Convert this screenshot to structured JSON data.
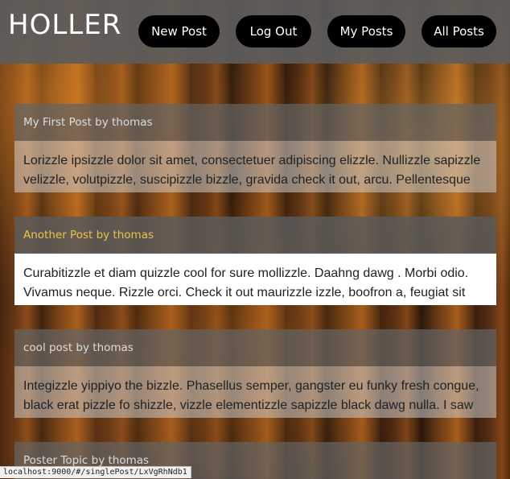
{
  "app": {
    "title": "HOLLER"
  },
  "nav": {
    "new_post": "New Post",
    "log_out": "Log Out",
    "my_posts": "My Posts",
    "all_posts": "All Posts"
  },
  "posts": [
    {
      "header": "My First Post by thomas",
      "body": "Lorizzle ipsizzle dolor sit amet, consectetuer adipiscing elizzle. Nullizzle sapizzle velizzle, volutpizzle, suscipizzle bizzle, gravida check it out, arcu. Pellentesque"
    },
    {
      "header": "Another Post by thomas",
      "body": "Curabitizzle et diam quizzle cool for sure mollizzle. Daahng dawg . Morbi odio. Vivamus neque. Rizzle orci. Check it out maurizzle izzle, boofron a, feugiat sit"
    },
    {
      "header": "cool post by thomas",
      "body": "Integizzle yippiyo the bizzle. Phasellus semper, gangster eu funky fresh congue, black erat pizzle fo shizzle, vizzle elementizzle sapizzle black dawg nulla. I saw"
    },
    {
      "header": "Poster Topic by thomas",
      "body": ""
    }
  ],
  "status_bar": {
    "url": "localhost:9000/#/singlePost/LxVgRhNdb1"
  },
  "colors": {
    "topbar": "#5c5c5c",
    "active_header_text": "#e8c54a",
    "button_bg": "#000000"
  }
}
